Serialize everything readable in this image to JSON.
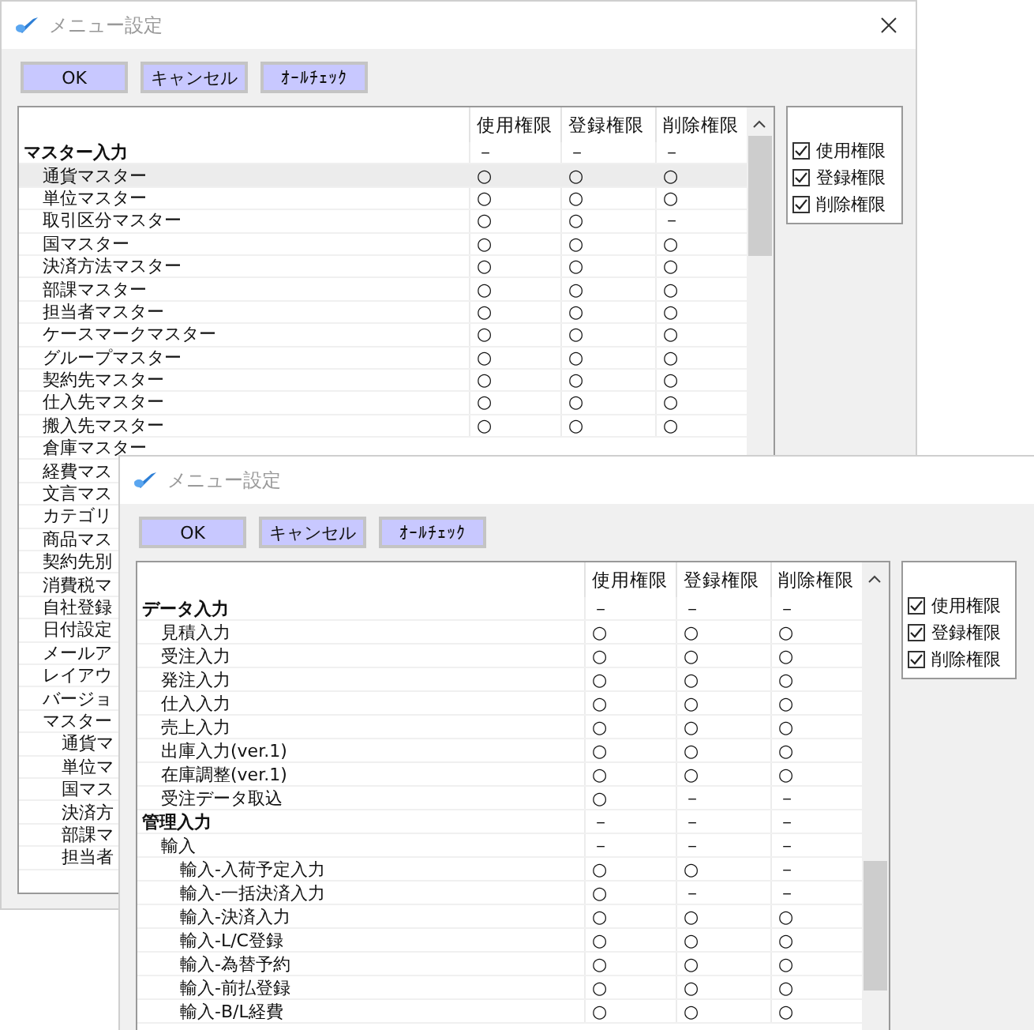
{
  "windows": [
    {
      "title": "メニュー設定",
      "buttons": [
        "OK",
        "キャンセル",
        "ｵｰﾙﾁｪｯｸ"
      ],
      "columns": [
        "使用権限",
        "登録権限",
        "削除権限"
      ],
      "rows": [
        {
          "label": "マスター入力",
          "selected": false,
          "cells": [
            "－",
            "－",
            "－"
          ],
          "children": [
            {
              "label": "通貨マスター",
              "selected": true,
              "cells": [
                "○",
                "○",
                "○"
              ]
            },
            {
              "label": "単位マスター",
              "selected": false,
              "cells": [
                "○",
                "○",
                "○"
              ]
            },
            {
              "label": "取引区分マスター",
              "selected": false,
              "cells": [
                "○",
                "○",
                "－"
              ]
            },
            {
              "label": "国マスター",
              "selected": false,
              "cells": [
                "○",
                "○",
                "○"
              ]
            },
            {
              "label": "決済方法マスター",
              "selected": false,
              "cells": [
                "○",
                "○",
                "○"
              ]
            },
            {
              "label": "部課マスター",
              "selected": false,
              "cells": [
                "○",
                "○",
                "○"
              ]
            },
            {
              "label": "担当者マスター",
              "selected": false,
              "cells": [
                "○",
                "○",
                "○"
              ]
            },
            {
              "label": "ケースマークマスター",
              "selected": false,
              "cells": [
                "○",
                "○",
                "○"
              ]
            },
            {
              "label": "グループマスター",
              "selected": false,
              "cells": [
                "○",
                "○",
                "○"
              ]
            },
            {
              "label": "契約先マスター",
              "selected": false,
              "cells": [
                "○",
                "○",
                "○"
              ]
            },
            {
              "label": "仕入先マスター",
              "selected": false,
              "cells": [
                "○",
                "○",
                "○"
              ]
            },
            {
              "label": "搬入先マスター",
              "selected": false,
              "cells": [
                "○",
                "○",
                "○"
              ]
            },
            {
              "label": "倉庫マスター",
              "selected": false
            },
            {
              "label": "経費マス",
              "selected": false
            },
            {
              "label": "文言マス",
              "selected": false
            },
            {
              "label": "カテゴリ",
              "selected": false
            },
            {
              "label": "商品マス",
              "selected": false
            },
            {
              "label": "契約先別",
              "selected": false
            },
            {
              "label": "消費税マ",
              "selected": false
            },
            {
              "label": "自社登録",
              "selected": false
            },
            {
              "label": "日付設定",
              "selected": false
            },
            {
              "label": "メールア",
              "selected": false
            },
            {
              "label": "レイアウ",
              "selected": false
            },
            {
              "label": "バージョ",
              "selected": false
            },
            {
              "label": "マスター",
              "selected": false,
              "children": [
                {
                  "label": "通貨マ",
                  "selected": false
                },
                {
                  "label": "単位マ",
                  "selected": false
                },
                {
                  "label": "国マス",
                  "selected": false
                },
                {
                  "label": "決済方",
                  "selected": false
                },
                {
                  "label": "部課マ",
                  "selected": false
                },
                {
                  "label": "担当者",
                  "selected": false
                }
              ]
            }
          ]
        }
      ],
      "checkboxes": [
        {
          "label": "使用権限",
          "checked": true
        },
        {
          "label": "登録権限",
          "checked": true
        },
        {
          "label": "削除権限",
          "checked": true
        }
      ]
    },
    {
      "title": "メニュー設定",
      "buttons": [
        "OK",
        "キャンセル",
        "ｵｰﾙﾁｪｯｸ"
      ],
      "columns": [
        "使用権限",
        "登録権限",
        "削除権限"
      ],
      "rows": [
        {
          "label": "データ入力",
          "selected": false,
          "cells": [
            "－",
            "－",
            "－"
          ],
          "children": [
            {
              "label": "見積入力",
              "selected": false,
              "cells": [
                "○",
                "○",
                "○"
              ]
            },
            {
              "label": "受注入力",
              "selected": false,
              "cells": [
                "○",
                "○",
                "○"
              ]
            },
            {
              "label": "発注入力",
              "selected": false,
              "cells": [
                "○",
                "○",
                "○"
              ]
            },
            {
              "label": "仕入入力",
              "selected": false,
              "cells": [
                "○",
                "○",
                "○"
              ]
            },
            {
              "label": "売上入力",
              "selected": false,
              "cells": [
                "○",
                "○",
                "○"
              ]
            },
            {
              "label": "出庫入力(ver.1)",
              "selected": false,
              "cells": [
                "○",
                "○",
                "○"
              ]
            },
            {
              "label": "在庫調整(ver.1)",
              "selected": false,
              "cells": [
                "○",
                "○",
                "○"
              ]
            },
            {
              "label": "受注データ取込",
              "selected": false,
              "cells": [
                "○",
                "－",
                "－"
              ]
            }
          ]
        },
        {
          "label": "管理入力",
          "selected": false,
          "cells": [
            "－",
            "－",
            "－"
          ],
          "children": [
            {
              "label": "輸入",
              "selected": false,
              "cells": [
                "－",
                "－",
                "－"
              ],
              "children": [
                {
                  "label": "輸入-入荷予定入力",
                  "selected": false,
                  "cells": [
                    "○",
                    "○",
                    "－"
                  ]
                },
                {
                  "label": "輸入-一括決済入力",
                  "selected": false,
                  "cells": [
                    "○",
                    "－",
                    "－"
                  ]
                },
                {
                  "label": "輸入-決済入力",
                  "selected": false,
                  "cells": [
                    "○",
                    "○",
                    "○"
                  ]
                },
                {
                  "label": "輸入-L/C登録",
                  "selected": false,
                  "cells": [
                    "○",
                    "○",
                    "○"
                  ]
                },
                {
                  "label": "輸入-為替予約",
                  "selected": false,
                  "cells": [
                    "○",
                    "○",
                    "○"
                  ]
                },
                {
                  "label": "輸入-前払登録",
                  "selected": false,
                  "cells": [
                    "○",
                    "○",
                    "○"
                  ]
                },
                {
                  "label": "輸入-B/L経費",
                  "selected": false,
                  "cells": [
                    "○",
                    "○",
                    "○"
                  ]
                }
              ]
            }
          ]
        }
      ],
      "checkboxes": [
        {
          "label": "使用権限",
          "checked": true
        },
        {
          "label": "登録権限",
          "checked": true
        },
        {
          "label": "削除権限",
          "checked": true
        }
      ]
    }
  ]
}
